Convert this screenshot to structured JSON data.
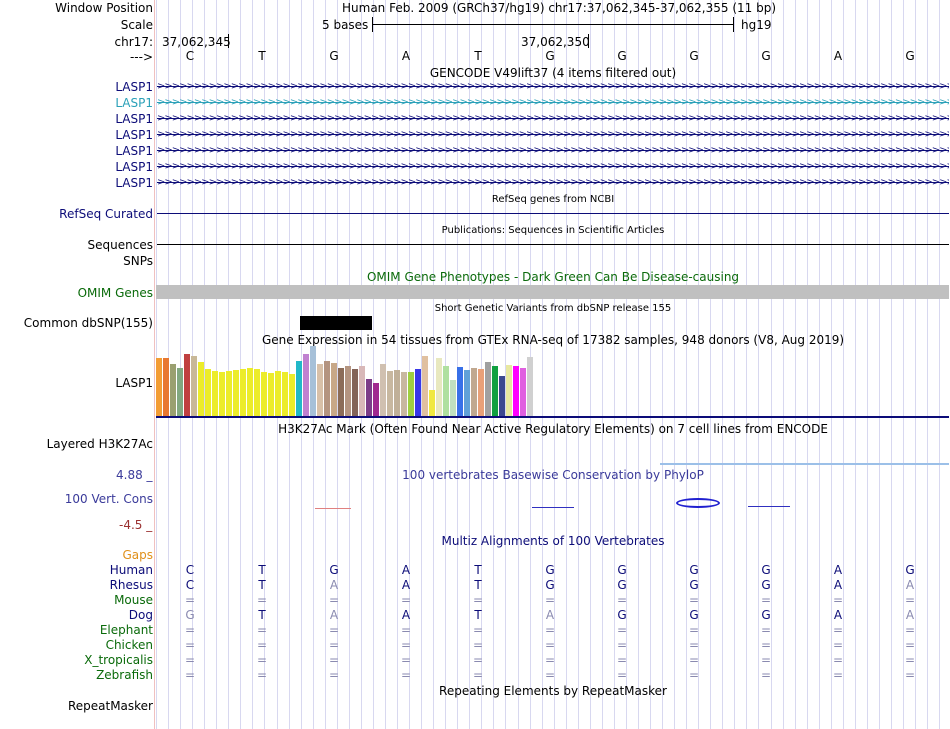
{
  "header": {
    "window_position_label": "Window Position",
    "window_position_value": "Human Feb. 2009 (GRCh37/hg19)   chr17:37,062,345-37,062,355 (11 bp)",
    "scale_label": "Scale",
    "scale_value": "5 bases",
    "scale_db": "hg19",
    "chrom_label": "chr17:",
    "pos_left": "37,062,345",
    "pos_mid": "37,062,350",
    "arrow_label": "--->"
  },
  "bases": [
    "C",
    "T",
    "G",
    "A",
    "T",
    "G",
    "G",
    "G",
    "G",
    "A",
    "G"
  ],
  "gencode": {
    "title": "GENCODE V49lift37 (4 items filtered out)",
    "tracks": [
      "LASP1",
      "LASP1",
      "LASP1",
      "LASP1",
      "LASP1",
      "LASP1",
      "LASP1"
    ],
    "colors": [
      "#0c0c78",
      "#2aa0b8",
      "#0c0c78",
      "#0c0c78",
      "#0c0c78",
      "#0c0c78",
      "#0c0c78"
    ]
  },
  "refseq": {
    "title": "RefSeq genes from NCBI",
    "label": "RefSeq Curated"
  },
  "publications": {
    "title": "Publications: Sequences in Scientific Articles",
    "label": "Sequences"
  },
  "snps_label": "SNPs",
  "omim": {
    "title": "OMIM Gene Phenotypes - Dark Green Can Be Disease-causing",
    "label": "OMIM Genes"
  },
  "dbsnp": {
    "title": "Short Genetic Variants from dbSNP release 155",
    "label": "Common dbSNP(155)"
  },
  "gtex": {
    "title": "Gene Expression in 54 tissues from GTEx RNA-seq of 17382 samples, 948 donors (V8, Aug 2019)",
    "label": "LASP1",
    "chart_data": {
      "type": "bar",
      "values": [
        58,
        58,
        52,
        48,
        62,
        60,
        54,
        47,
        45,
        44,
        45,
        46,
        47,
        48,
        47,
        44,
        43,
        45,
        44,
        42,
        55,
        62,
        70,
        52,
        55,
        53,
        48,
        50,
        47,
        50,
        37,
        33,
        52,
        45,
        46,
        44,
        44,
        47,
        60,
        26,
        58,
        50,
        36,
        49,
        46,
        48,
        47,
        54,
        50,
        40,
        51,
        50,
        48,
        59
      ],
      "colors": [
        "#f39c33",
        "#e87730",
        "#9aa070",
        "#82a880",
        "#c04040",
        "#c8b898",
        "#ecec2a",
        "#ecec2a",
        "#ecec2a",
        "#ecec2a",
        "#ecec2a",
        "#ecec2a",
        "#ecec2a",
        "#ecec2a",
        "#ecec2a",
        "#ecec2a",
        "#ecec2a",
        "#ecec2a",
        "#ecec2a",
        "#ecec2a",
        "#21b8c8",
        "#c080d0",
        "#a6c0d8",
        "#d8c0a8",
        "#b49480",
        "#c8a888",
        "#8c6c58",
        "#b49480",
        "#846458",
        "#d8b8b8",
        "#7c3c88",
        "#a02890",
        "#d0c0b0",
        "#c8b8a0",
        "#c0b098",
        "#c8b8a0",
        "#a0d040",
        "#3838e8",
        "#e0c0a0",
        "#f0e840",
        "#e8e8c0",
        "#b0e0a0",
        "#c0e0c0",
        "#3870e8",
        "#60a0d8",
        "#c0a890",
        "#e8a078",
        "#a0a0a0",
        "#10a040",
        "#3c4890",
        "#e8e8a0",
        "#ff00ff",
        "#e060e0",
        "#d0d0d0"
      ]
    }
  },
  "h3k27ac": {
    "title": "H3K27Ac Mark (Often Found Near Active Regulatory Elements) on 7 cell lines from ENCODE",
    "label": "Layered H3K27Ac"
  },
  "phylop": {
    "title": "100 vertebrates Basewise Conservation by PhyloP",
    "label": "100 Vert. Cons",
    "max": "4.88 _",
    "min": "-4.5 _"
  },
  "multiz": {
    "title": "Multiz Alignments of 100 Vertebrates",
    "gaps_label": "Gaps",
    "species": [
      {
        "name": "Human",
        "bases": [
          "C",
          "T",
          "G",
          "A",
          "T",
          "G",
          "G",
          "G",
          "G",
          "A",
          "G"
        ],
        "dim": [
          0,
          0,
          0,
          0,
          0,
          0,
          0,
          0,
          0,
          0,
          0
        ]
      },
      {
        "name": "Rhesus",
        "bases": [
          "C",
          "T",
          "A",
          "A",
          "T",
          "G",
          "G",
          "G",
          "G",
          "A",
          "A"
        ],
        "dim": [
          0,
          0,
          1,
          0,
          0,
          0,
          0,
          0,
          0,
          0,
          1
        ]
      },
      {
        "name": "Mouse",
        "bases": [
          "=",
          "=",
          "=",
          "=",
          "=",
          "=",
          "=",
          "=",
          "=",
          "=",
          "="
        ],
        "dim": [
          1,
          1,
          1,
          1,
          1,
          1,
          1,
          1,
          1,
          1,
          1
        ]
      },
      {
        "name": "Dog",
        "bases": [
          "G",
          "T",
          "A",
          "A",
          "T",
          "A",
          "G",
          "G",
          "G",
          "A",
          "A"
        ],
        "dim": [
          1,
          0,
          1,
          0,
          0,
          1,
          0,
          0,
          0,
          0,
          1
        ]
      },
      {
        "name": "Elephant",
        "bases": [
          "=",
          "=",
          "=",
          "=",
          "=",
          "=",
          "=",
          "=",
          "=",
          "=",
          "="
        ],
        "dim": [
          1,
          1,
          1,
          1,
          1,
          1,
          1,
          1,
          1,
          1,
          1
        ]
      },
      {
        "name": "Chicken",
        "bases": [
          "=",
          "=",
          "=",
          "=",
          "=",
          "=",
          "=",
          "=",
          "=",
          "=",
          "="
        ],
        "dim": [
          1,
          1,
          1,
          1,
          1,
          1,
          1,
          1,
          1,
          1,
          1
        ]
      },
      {
        "name": "X_tropicalis",
        "bases": [
          "=",
          "=",
          "=",
          "=",
          "=",
          "=",
          "=",
          "=",
          "=",
          "=",
          "="
        ],
        "dim": [
          1,
          1,
          1,
          1,
          1,
          1,
          1,
          1,
          1,
          1,
          1
        ]
      },
      {
        "name": "Zebrafish",
        "bases": [
          "=",
          "=",
          "=",
          "=",
          "=",
          "=",
          "=",
          "=",
          "=",
          "=",
          "="
        ],
        "dim": [
          1,
          1,
          1,
          1,
          1,
          1,
          1,
          1,
          1,
          1,
          1
        ]
      }
    ]
  },
  "repeatmasker": {
    "title": "Repeating Elements by RepeatMasker",
    "label": "RepeatMasker"
  }
}
